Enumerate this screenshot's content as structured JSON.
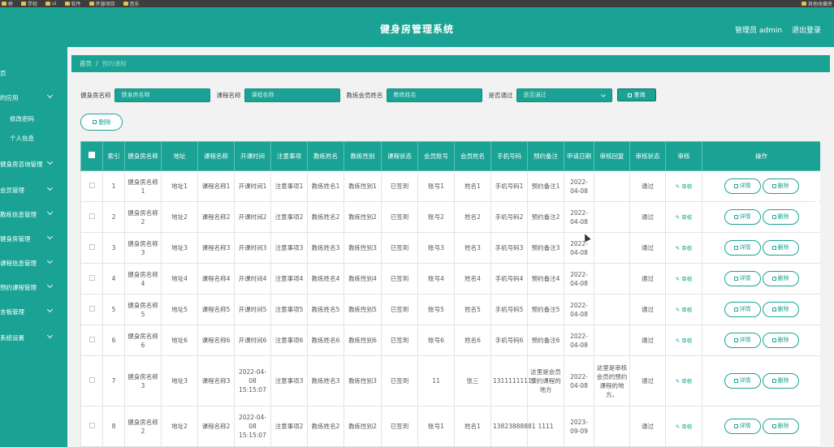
{
  "bookmarks": [
    "桥",
    "学校",
    "ui",
    "软件",
    "开源项目",
    "音乐"
  ],
  "bookmark_right": "其他收藏夹",
  "header": {
    "title": "健身房管理系统",
    "user": "管理员 admin",
    "logout": "退出登录"
  },
  "sidebar": [
    {
      "label": "页",
      "kind": "top"
    },
    {
      "label": "的应用",
      "kind": "group"
    },
    {
      "label": "修改密码",
      "kind": "sub"
    },
    {
      "label": "个人信息",
      "kind": "sub"
    },
    {
      "label": "健身房咨询管理",
      "kind": "group"
    },
    {
      "label": "会员管理",
      "kind": "group"
    },
    {
      "label": "教练信息管理",
      "kind": "group"
    },
    {
      "label": "健身房管理",
      "kind": "group"
    },
    {
      "label": "课程信息管理",
      "kind": "group"
    },
    {
      "label": "预约课程管理",
      "kind": "group"
    },
    {
      "label": "言板管理",
      "kind": "group"
    },
    {
      "label": "系统设置",
      "kind": "group"
    }
  ],
  "breadcrumb": {
    "home": "首页",
    "sep": "/",
    "current": "预约课程"
  },
  "search": {
    "gym_label": "健身房名称",
    "gym_placeholder": "健身房名称",
    "course_label": "课程名称",
    "course_placeholder": "课程名称",
    "coach_label": "教练会员姓名",
    "coach_placeholder": "教练姓名",
    "pass_label": "是否通过",
    "pass_placeholder": "是否通过",
    "query": "查询"
  },
  "delete_label": "删除",
  "table": {
    "headers": [
      "索引",
      "健身房名称",
      "地址",
      "课程名称",
      "开课时间",
      "注意事项",
      "教练姓名",
      "教练性别",
      "课程状态",
      "会员账号",
      "会员姓名",
      "手机号码",
      "预约备注",
      "申请日期",
      "审核回复",
      "审核状态",
      "审核",
      "操作"
    ],
    "audit_label": "审核",
    "detail_label": "详情",
    "delete_label": "删除",
    "rows": [
      [
        "1",
        "健身房名称1",
        "地址1",
        "课程名称1",
        "开课时间1",
        "注意事项1",
        "教练姓名1",
        "教练性别1",
        "已签到",
        "账号1",
        "姓名1",
        "手机号码1",
        "预约备注1",
        "2022-04-08",
        "",
        "通过"
      ],
      [
        "2",
        "健身房名称2",
        "地址2",
        "课程名称2",
        "开课时间2",
        "注意事项2",
        "教练姓名2",
        "教练性别2",
        "已签到",
        "账号2",
        "姓名2",
        "手机号码2",
        "预约备注2",
        "2022-04-08",
        "",
        "通过"
      ],
      [
        "3",
        "健身房名称3",
        "地址3",
        "课程名称3",
        "开课时间3",
        "注意事项3",
        "教练姓名3",
        "教练性别3",
        "已签到",
        "账号3",
        "姓名3",
        "手机号码3",
        "预约备注3",
        "2022-04-08",
        "",
        "通过"
      ],
      [
        "4",
        "健身房名称4",
        "地址4",
        "课程名称4",
        "开课时间4",
        "注意事项4",
        "教练姓名4",
        "教练性别4",
        "已签到",
        "账号4",
        "姓名4",
        "手机号码4",
        "预约备注4",
        "2022-04-08",
        "",
        "通过"
      ],
      [
        "5",
        "健身房名称5",
        "地址5",
        "课程名称5",
        "开课时间5",
        "注意事项5",
        "教练姓名5",
        "教练性别5",
        "已签到",
        "账号5",
        "姓名5",
        "手机号码5",
        "预约备注5",
        "2022-04-08",
        "",
        "通过"
      ],
      [
        "6",
        "健身房名称6",
        "地址6",
        "课程名称6",
        "开课时间6",
        "注意事项6",
        "教练姓名6",
        "教练性别6",
        "已签到",
        "账号6",
        "姓名6",
        "手机号码6",
        "预约备注6",
        "2022-04-08",
        "",
        "通过"
      ],
      [
        "7",
        "健身房名称3",
        "地址3",
        "课程名称3",
        "2022-04-08 15:15:07",
        "注意事项3",
        "教练姓名3",
        "教练性别3",
        "已签到",
        "11",
        "张三",
        "13111111111",
        "这里是会员预约课程的地方",
        "2022-04-08",
        "这里是审核会员的预约课程的地方。",
        "通过"
      ],
      [
        "8",
        "健身房名称2",
        "地址2",
        "课程名称2",
        "2022-04-08 15:15:07",
        "注意事项2",
        "教练姓名2",
        "教练性别2",
        "已签到",
        "账号1",
        "姓名1",
        "13823888881",
        "1111",
        "2023-09-09",
        "",
        "通过"
      ]
    ]
  }
}
